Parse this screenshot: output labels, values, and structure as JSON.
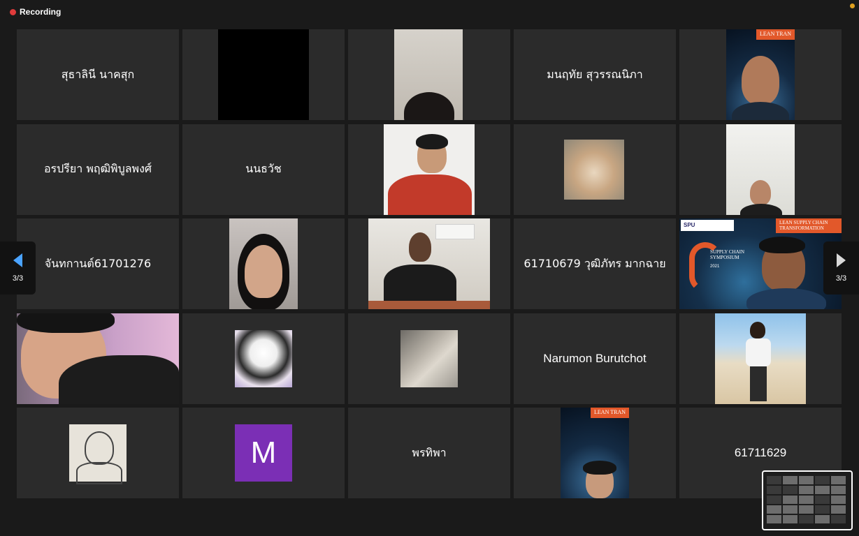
{
  "recording": {
    "label": "Recording"
  },
  "colors": {
    "recording_dot": "#e03b3b",
    "nav_arrow_left": "#4aa3ff",
    "avatar_m": "#7b2fb5",
    "tag_orange": "#e2582a"
  },
  "banner": {
    "tag": "LEAN SUPPLY CHAIN TRANSFORMATION",
    "tag_short": "LEAN TRAN",
    "spu": "SPU",
    "symposium": "SUPPLY CHAIN SYMPOSIUM",
    "year": "2021"
  },
  "tiles": {
    "r1c1": "สุธาลินี นาคสุก",
    "r1c4": "มนฤทัย สุวรรณนิภา",
    "r2c1": "อรปรียา พฤฒิพิบูลพงศ์",
    "r2c2": "นนธวัช",
    "r3c1": "จันทกานต์61701276",
    "r3c4": "61710679 วุฒิภัทร มากฉาย",
    "r4c4": "Narumon Burutchot",
    "r5c2_avatar": "M",
    "r5c3": "พรทิพา",
    "r5c5": "61711629"
  },
  "pagination": {
    "left": "3/3",
    "right": "3/3"
  },
  "icons": {
    "prev": "chevron-left-icon",
    "next": "chevron-right-icon"
  }
}
